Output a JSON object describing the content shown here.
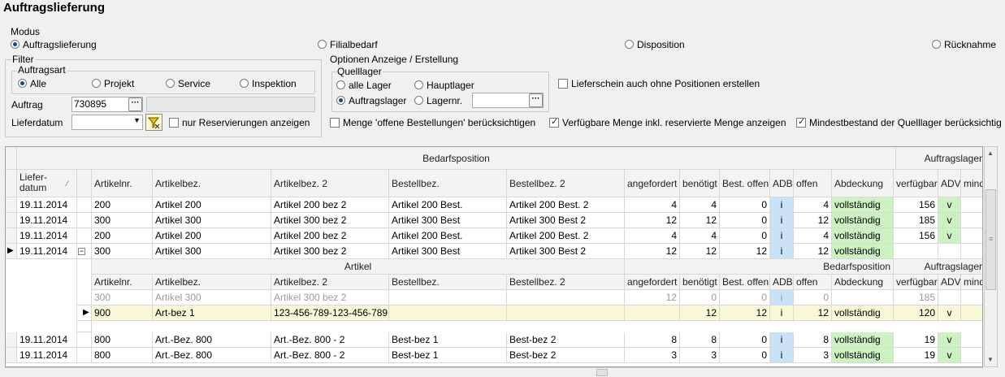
{
  "title": "Auftragslieferung",
  "modus": {
    "label": "Modus",
    "options": [
      "Auftragslieferung",
      "Filialbedarf",
      "Disposition",
      "Rücknahme"
    ],
    "selected": "Auftragslieferung"
  },
  "filter": {
    "label": "Filter",
    "auftragsart_label": "Auftragsart",
    "auftragsart_options": [
      "Alle",
      "Projekt",
      "Service",
      "Inspektion"
    ],
    "auftrag_label": "Auftrag",
    "auftrag_value": "730895",
    "lieferdatum_label": "Lieferdatum",
    "nur_reservierungen": "nur Reservierungen anzeigen"
  },
  "optionen": {
    "label": "Optionen Anzeige / Erstellung",
    "quelllager_label": "Quelllager",
    "quell_options": [
      "alle Lager",
      "Hauptlager",
      "Auftragslager",
      "Lagernr."
    ],
    "lieferschein": "Lieferschein auch ohne Positionen erstellen",
    "menge_offene": "Menge 'offene Bestellungen' berücksichtigen",
    "verfuegbare": "Verfügbare Menge inkl. reservierte Menge anzeigen",
    "mindestbestand": "Mindestbestand der Quelllager berücksichtig"
  },
  "grid": {
    "group_bedarf": "Bedarfsposition",
    "group_auftragslager": "Auftragslager",
    "columns": [
      "Liefer-\ndatum",
      "Artikelnr.",
      "Artikelbez.",
      "Artikelbez. 2",
      "Bestellbez.",
      "Bestellbez. 2",
      "angefordert",
      "benötigt",
      "Best. offen",
      "ADB",
      "offen",
      "Abdeckung",
      "verfügbar",
      "ADV",
      "mind"
    ],
    "rows": [
      {
        "datum": "19.11.2014",
        "nr": "200",
        "bez": "Artikel 200",
        "bez2": "Artikel 200 bez 2",
        "best": "Artikel 200 Best.",
        "best2": "Artikel 200 Best. 2",
        "angef": "4",
        "benoe": "4",
        "boffen": "0",
        "adb": "i",
        "offen": "4",
        "deck": "vollständig",
        "verf": "156",
        "adv": "v"
      },
      {
        "datum": "19.11.2014",
        "nr": "300",
        "bez": "Artikel 300",
        "bez2": "Artikel 300 bez 2",
        "best": "Artikel 300 Best",
        "best2": "Artikel 300 Best 2",
        "angef": "12",
        "benoe": "12",
        "boffen": "0",
        "adb": "i",
        "offen": "12",
        "deck": "vollständig",
        "verf": "185",
        "adv": "v"
      },
      {
        "datum": "19.11.2014",
        "nr": "200",
        "bez": "Artikel 200",
        "bez2": "Artikel 200 bez 2",
        "best": "Artikel 200 Best.",
        "best2": "Artikel 200 Best. 2",
        "angef": "4",
        "benoe": "4",
        "boffen": "0",
        "adb": "i",
        "offen": "4",
        "deck": "vollständig",
        "verf": "156",
        "adv": "v"
      },
      {
        "datum": "19.11.2014",
        "nr": "300",
        "bez": "Artikel 300",
        "bez2": "Artikel 300 bez 2",
        "best": "Artikel 300 Best",
        "best2": "Artikel 300 Best 2",
        "angef": "12",
        "benoe": "12",
        "boffen": "12",
        "adb": "i",
        "offen": "12",
        "deck": "vollständig",
        "verf": "",
        "adv": ""
      }
    ],
    "sub": {
      "group_artikel": "Artikel",
      "group_bedarf": "Bedarfsposition",
      "group_auftragslager": "Auftragslager",
      "columns": [
        "Artikelnr.",
        "Artikelbez.",
        "Artikelbez. 2",
        "Bestellbez.",
        "Bestellbez. 2",
        "angefordert",
        "benötigt",
        "Best. offen",
        "ADB",
        "offen",
        "Abdeckung",
        "verfügbar",
        "ADV",
        "mind"
      ],
      "rows": [
        {
          "nr": "300",
          "bez": "Artikel 300",
          "bez2": "Artikel 300 bez 2",
          "angef": "12",
          "benoe": "0",
          "boffen": "0",
          "adb": "i",
          "offen": "0",
          "deck": "",
          "verf": "185",
          "adv": ""
        },
        {
          "nr": "900",
          "bez": "Art-bez 1",
          "bez2": "123-456-789-123-456-789",
          "angef": "",
          "benoe": "12",
          "boffen": "12",
          "adb": "i",
          "offen": "12",
          "deck": "vollständig",
          "verf": "120",
          "adv": "v"
        }
      ]
    },
    "rows2": [
      {
        "datum": "19.11.2014",
        "nr": "800",
        "bez": "Art.-Bez. 800",
        "bez2": "Art.-Bez. 800 - 2",
        "best": "Best-bez 1",
        "best2": "Best-bez 2",
        "angef": "8",
        "benoe": "8",
        "boffen": "0",
        "adb": "i",
        "offen": "8",
        "deck": "vollständig",
        "verf": "19",
        "adv": "v"
      },
      {
        "datum": "19.11.2014",
        "nr": "800",
        "bez": "Art.-Bez. 800",
        "bez2": "Art.-Bez. 800 - 2",
        "best": "Best-bez 1",
        "best2": "Best-bez 2",
        "angef": "3",
        "benoe": "3",
        "boffen": "0",
        "adb": "i",
        "offen": "3",
        "deck": "vollständig",
        "verf": "19",
        "adv": "v"
      }
    ]
  }
}
